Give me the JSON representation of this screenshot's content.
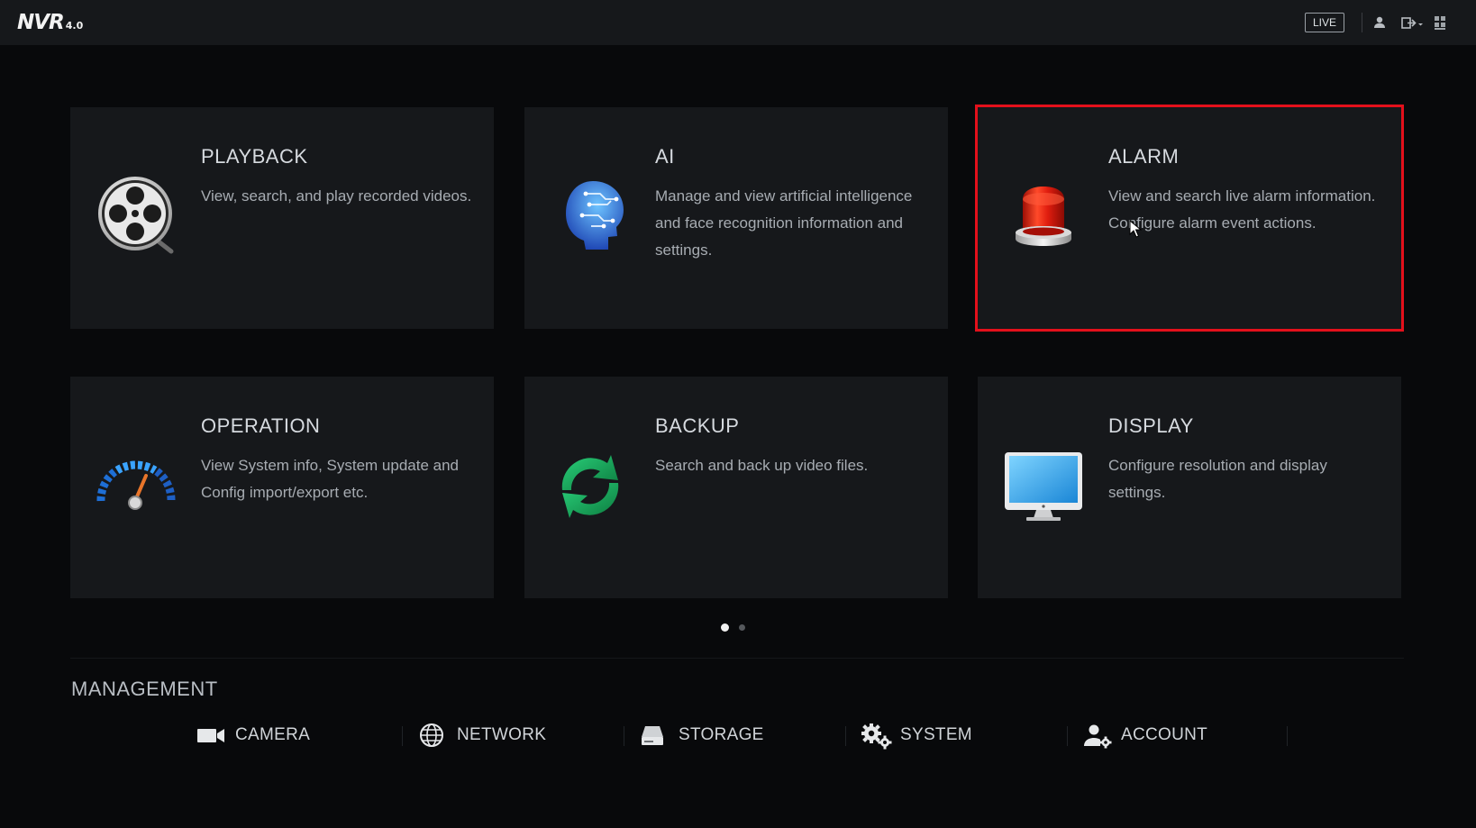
{
  "app": {
    "logo": "NVR",
    "version": "4.0"
  },
  "topbar": {
    "live_label": "LIVE",
    "icons": [
      "user-icon",
      "logout-icon",
      "grid-menu-icon"
    ]
  },
  "cards": [
    {
      "id": "playback",
      "title": "PLAYBACK",
      "description": "View, search, and play recorded videos.",
      "icon": "film-reel-icon"
    },
    {
      "id": "ai",
      "title": "AI",
      "description": "Manage and view artificial intelligence and face recognition information and settings.",
      "icon": "ai-head-icon"
    },
    {
      "id": "alarm",
      "title": "ALARM",
      "description": "View and search live alarm information. Configure alarm event actions.",
      "icon": "alarm-light-icon",
      "selected": true
    },
    {
      "id": "operation",
      "title": "OPERATION",
      "description": "View System info, System update and Config import/export etc.",
      "icon": "gauge-icon"
    },
    {
      "id": "backup",
      "title": "BACKUP",
      "description": "Search and back up video files.",
      "icon": "sync-icon"
    },
    {
      "id": "display",
      "title": "DISPLAY",
      "description": "Configure resolution and display settings.",
      "icon": "monitor-icon"
    }
  ],
  "pagination": {
    "pages": 2,
    "current": 1
  },
  "management": {
    "title": "MANAGEMENT",
    "items": [
      {
        "label": "CAMERA",
        "icon": "camera-icon"
      },
      {
        "label": "NETWORK",
        "icon": "globe-icon"
      },
      {
        "label": "STORAGE",
        "icon": "hard-drive-icon"
      },
      {
        "label": "SYSTEM",
        "icon": "gears-icon"
      },
      {
        "label": "ACCOUNT",
        "icon": "user-settings-icon"
      }
    ]
  },
  "colors": {
    "background": "#08090b",
    "card": "#16181b",
    "highlight": "#e3101b",
    "text": "#d6dadf"
  }
}
